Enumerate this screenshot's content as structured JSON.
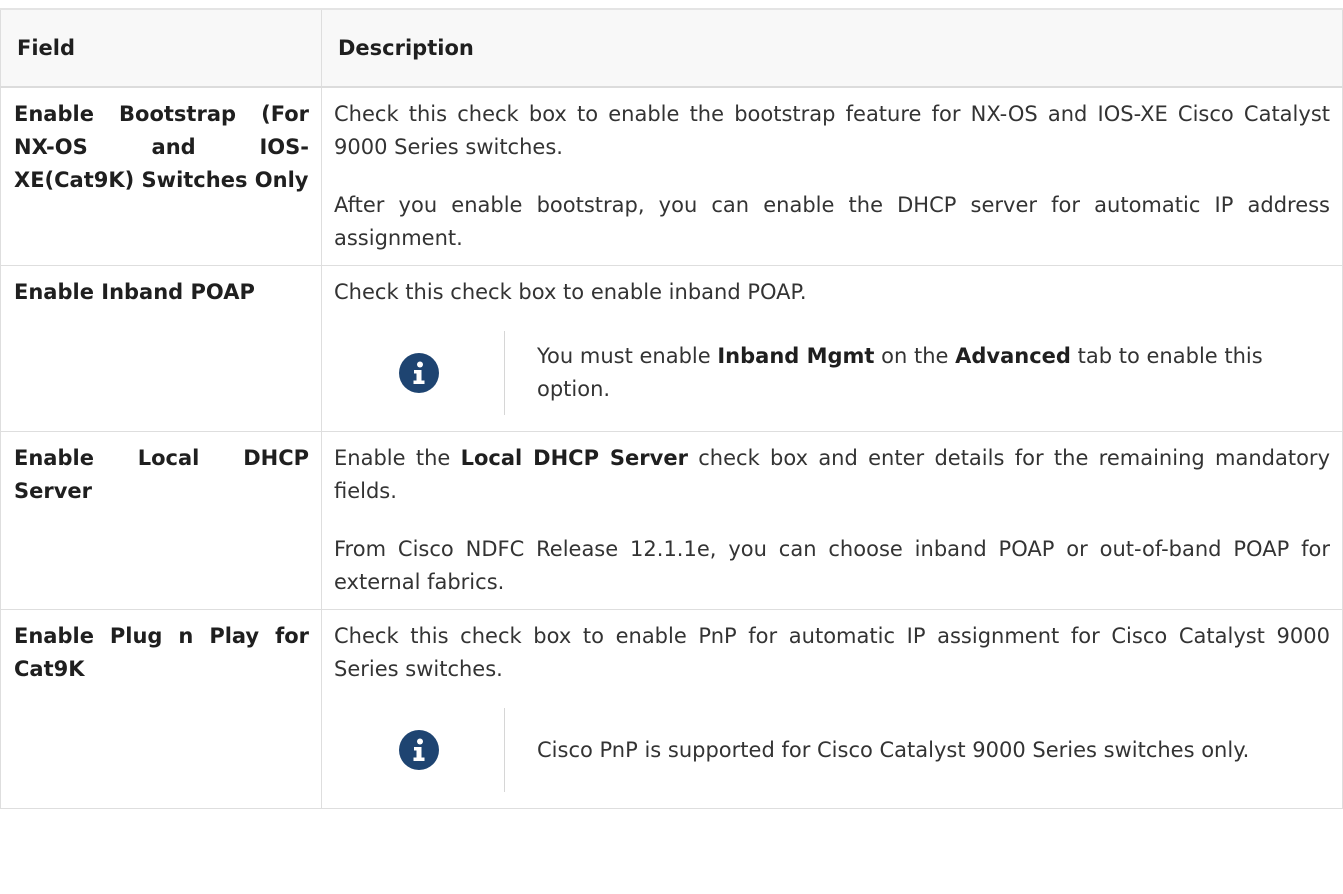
{
  "header": {
    "field": "Field",
    "description": "Description"
  },
  "rows": [
    {
      "field": "Enable Bootstrap (For NX-OS and IOS-XE(Cat9K) Switches Only",
      "p1": "Check this check box to enable the bootstrap feature for NX-OS and IOS-XE Cisco Catalyst 9000 Series switches.",
      "p2": "After you enable bootstrap, you can enable the DHCP server for automatic IP address assignment."
    },
    {
      "field": "Enable Inband POAP",
      "p1": "Check this check box to enable inband POAP.",
      "note": {
        "pre": "You must enable ",
        "b1": "Inband Mgmt",
        "mid": " on the ",
        "b2": "Advanced",
        "post": " tab to enable this option."
      }
    },
    {
      "field": "Enable Local DHCP Server",
      "p1_pre": "Enable the ",
      "p1_bold": "Local DHCP Server",
      "p1_post": " check box and enter details for the remaining mandatory fields.",
      "p2": "From Cisco NDFC Release 12.1.1e, you can choose inband POAP or out-of-band POAP for external fabrics."
    },
    {
      "field": "Enable Plug n Play for Cat9K",
      "p1": "Check this check box to enable PnP for automatic IP assignment for Cisco Catalyst 9000 Series switches.",
      "note": "Cisco PnP is supported for Cisco Catalyst 9000 Series switches only."
    }
  ],
  "icons": {
    "note": "info-icon"
  },
  "colors": {
    "icon_bg": "#1e4471",
    "header_bg": "#f8f8f8",
    "border": "#dedede"
  }
}
